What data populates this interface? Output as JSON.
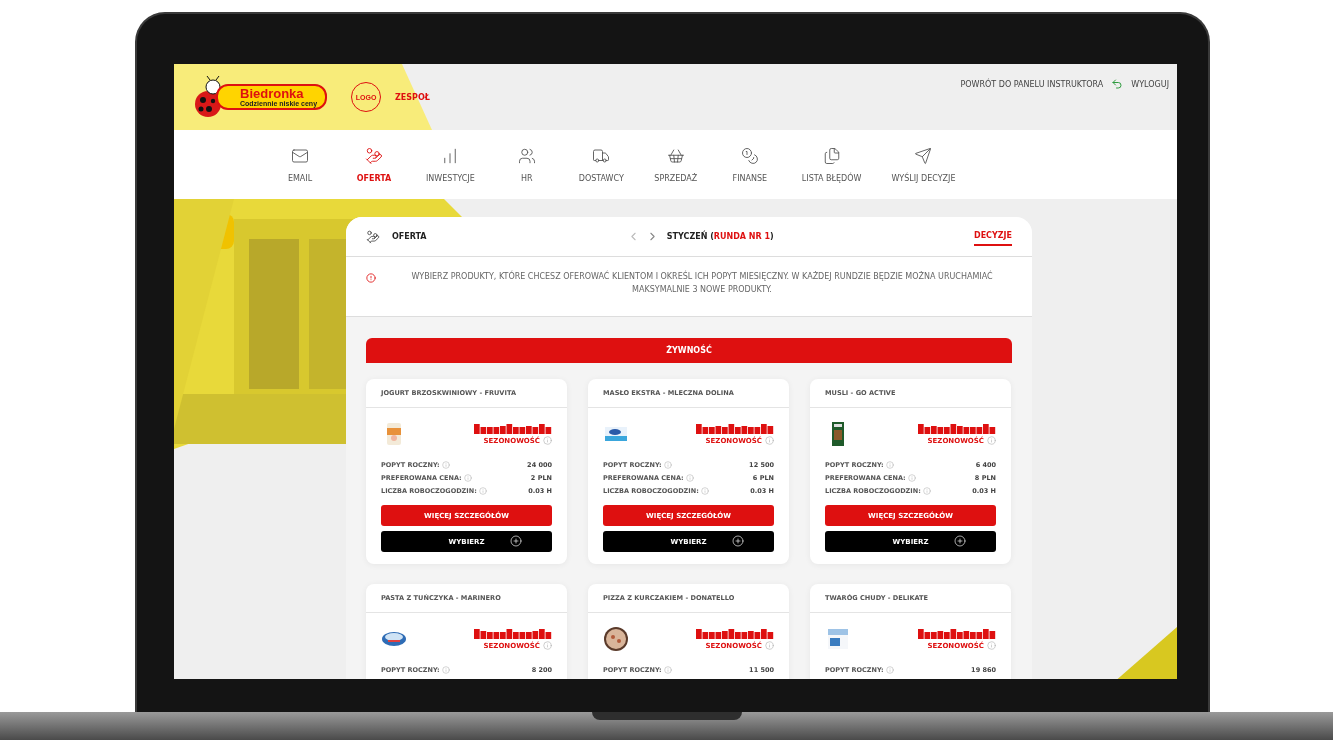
{
  "header": {
    "brand_name": "Biedronka",
    "brand_tagline": "Codziennie niskie ceny",
    "team_logo": "LOGO",
    "team_name": "ZESPOŁ",
    "back_link": "POWRÓT DO PANELU INSTRUKTORA",
    "logout_link": "WYLOGUJ"
  },
  "nav": [
    {
      "label": "EMAIL",
      "selected": false
    },
    {
      "label": "OFERTA",
      "selected": true
    },
    {
      "label": "INWESTYCJE",
      "selected": false
    },
    {
      "label": "HR",
      "selected": false
    },
    {
      "label": "DOSTAWCY",
      "selected": false
    },
    {
      "label": "SPRZEDAŻ",
      "selected": false
    },
    {
      "label": "FINANSE",
      "selected": false
    },
    {
      "label": "LISTA BŁĘDÓW",
      "selected": false
    },
    {
      "label": "WYŚLIJ DECYZJE",
      "selected": false
    }
  ],
  "panel": {
    "title": "OFERTA",
    "period_open": "STYCZEŃ (",
    "round": "RUNDA NR 1",
    "period_close": ")",
    "tab": {
      "label": "DECYZJE",
      "selected": true
    },
    "notice": "WYBIERZ PRODUKTY, KTÓRE CHCESZ OFEROWAĆ KLIENTOM I OKREŚL ICH POPYT MIESIĘCZNY. W KAŻDEJ RUNDZIE BĘDZIE MOŻNA URUCHAMIAĆ MAKSYMALNIE 3 NOWE PRODUKTY.",
    "category": "ŻYWNOŚĆ",
    "products": [
      {
        "name": "JOGURT BRZOSKWINIOWY - FRUVITA",
        "seasonality_label": "SEZONOWOŚĆ",
        "stats": [
          {
            "label": "POPYT ROCZNY:",
            "value": "24 000"
          },
          {
            "label": "PREFEROWANA CENA:",
            "value": "2 PLN"
          },
          {
            "label": "LICZBA ROBOCZOGODZIN:",
            "value": "0.03 H"
          }
        ],
        "details_button": "WIĘCEJ SZCZEGÓŁÓW",
        "select_button": "WYBIERZ"
      },
      {
        "name": "MASŁO EKSTRA - MLECZNA DOLINA",
        "seasonality_label": "SEZONOWOŚĆ",
        "stats": [
          {
            "label": "POPYT ROCZNY:",
            "value": "12 500"
          },
          {
            "label": "PREFEROWANA CENA:",
            "value": "6 PLN"
          },
          {
            "label": "LICZBA ROBOCZOGODZIN:",
            "value": "0.03 H"
          }
        ],
        "details_button": "WIĘCEJ SZCZEGÓŁÓW",
        "select_button": "WYBIERZ"
      },
      {
        "name": "MUSLI - GO ACTIVE",
        "seasonality_label": "SEZONOWOŚĆ",
        "stats": [
          {
            "label": "POPYT ROCZNY:",
            "value": "6 400"
          },
          {
            "label": "PREFEROWANA CENA:",
            "value": "8 PLN"
          },
          {
            "label": "LICZBA ROBOCZOGODZIN:",
            "value": "0.03 H"
          }
        ],
        "details_button": "WIĘCEJ SZCZEGÓŁÓW",
        "select_button": "WYBIERZ"
      },
      {
        "name": "PASTA Z TUŃCZYKA - MARINERO",
        "seasonality_label": "SEZONOWOŚĆ",
        "stats": [
          {
            "label": "POPYT ROCZNY:",
            "value": "8 200"
          }
        ]
      },
      {
        "name": "PIZZA Z KURCZAKIEM - DONATELLO",
        "seasonality_label": "SEZONOWOŚĆ",
        "stats": [
          {
            "label": "POPYT ROCZNY:",
            "value": "11 500"
          }
        ]
      },
      {
        "name": "TWARÓG CHUDY - DELIKATE",
        "seasonality_label": "SEZONOWOŚĆ",
        "stats": [
          {
            "label": "POPYT ROCZNY:",
            "value": "19 860"
          }
        ]
      }
    ]
  }
}
